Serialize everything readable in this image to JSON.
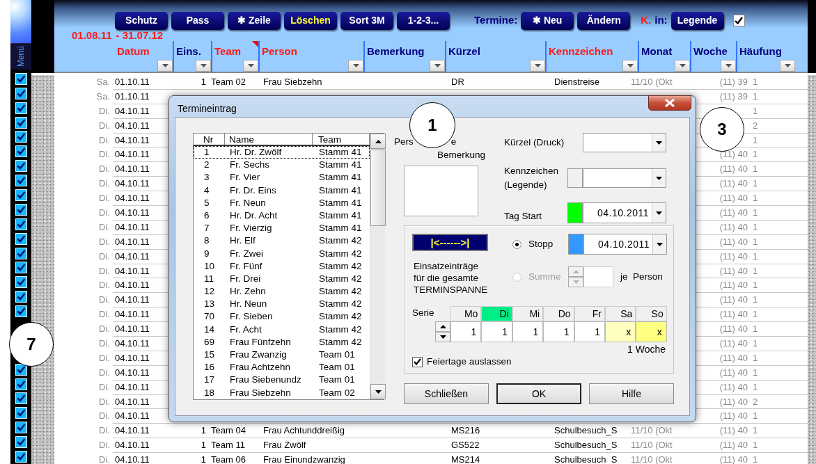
{
  "menu_label": "Menü",
  "toolbar": {
    "buttons": [
      {
        "label": "Schutz",
        "emphasis": false
      },
      {
        "label": "Pass",
        "emphasis": false
      },
      {
        "label": "✱ Zeile",
        "emphasis": false
      },
      {
        "label": "Löschen",
        "emphasis": true
      },
      {
        "label": "Sort 3M",
        "emphasis": false
      },
      {
        "label": "1-2-3...",
        "emphasis": false
      }
    ],
    "termine_label": "Termine:",
    "termine_buttons": [
      {
        "label": "✱ Neu"
      },
      {
        "label": "Ändern"
      }
    ],
    "k_label": "K.",
    "in_label": "in:",
    "legend_button": "Legende",
    "legend_checked": true,
    "date_from": "01.08.11",
    "date_to": "- 31.07.12"
  },
  "columns": [
    {
      "label": "Datum",
      "color": "#ff1a1a",
      "has_comment": false
    },
    {
      "label": "Eins.",
      "color": "#000080",
      "has_comment": false
    },
    {
      "label": "Team",
      "color": "#ff1a1a",
      "has_comment": true
    },
    {
      "label": "Person",
      "color": "#ff1a1a",
      "has_comment": false
    },
    {
      "label": "Bemerkung",
      "color": "#000080",
      "has_comment": false
    },
    {
      "label": "Kürzel",
      "color": "#000080",
      "has_comment": false
    },
    {
      "label": "Kennzeichen",
      "color": "#ff1a1a",
      "has_comment": false
    },
    {
      "label": "Monat",
      "color": "#000080",
      "has_comment": false
    },
    {
      "label": "Woche",
      "color": "#000080",
      "has_comment": false
    },
    {
      "label": "Häufung",
      "color": "#000080",
      "has_comment": false
    }
  ],
  "rows": [
    {
      "checked": true,
      "weekday": "Sa.",
      "date": "01.10.11",
      "eins": "1",
      "team": "Team 02",
      "person": "Frau Siebzehn",
      "kuerzel": "DR",
      "kennzeichen": "Dienstreise",
      "monat": "11/10 (Okt",
      "woche": "(11) 39",
      "haeufung": "1"
    },
    {
      "checked": true,
      "weekday": "Sa.",
      "date": "01.10.11",
      "woche": "(11) 39",
      "haeufung": "1"
    },
    {
      "checked": true,
      "weekday": "Di.",
      "date": "04.10.11",
      "haeufung": "1"
    },
    {
      "checked": true,
      "weekday": "Di.",
      "date": "04.10.11",
      "haeufung": "2"
    },
    {
      "checked": true,
      "weekday": "Di.",
      "date": "04.10.11",
      "haeufung": "1"
    },
    {
      "checked": true,
      "weekday": "Di.",
      "date": "04.10.11",
      "woche": "(11) 40",
      "haeufung": "1"
    },
    {
      "checked": true,
      "weekday": "Di.",
      "date": "04.10.11",
      "woche": "(11) 40",
      "haeufung": "1"
    },
    {
      "checked": true,
      "weekday": "Di.",
      "date": "04.10.11",
      "woche": "(11) 40",
      "haeufung": "1"
    },
    {
      "checked": true,
      "weekday": "Di.",
      "date": "04.10.11",
      "woche": "(11) 40",
      "haeufung": "1"
    },
    {
      "checked": true,
      "weekday": "Di.",
      "date": "04.10.11",
      "woche": "(11) 40",
      "haeufung": "1"
    },
    {
      "checked": true,
      "weekday": "Di.",
      "date": "04.10.11",
      "woche": "(11) 40",
      "haeufung": "1"
    },
    {
      "checked": true,
      "weekday": "Di.",
      "date": "04.10.11",
      "woche": "(11) 40",
      "haeufung": "1"
    },
    {
      "checked": true,
      "weekday": "Di.",
      "date": "04.10.11",
      "woche": "(11) 40",
      "haeufung": "1"
    },
    {
      "checked": true,
      "weekday": "Di.",
      "date": "04.10.11",
      "woche": "(11) 40",
      "haeufung": "1"
    },
    {
      "checked": true,
      "weekday": "Di.",
      "date": "04.10.11",
      "woche": "(11) 40",
      "haeufung": "1"
    },
    {
      "checked": true,
      "weekday": "Di.",
      "date": "04.10.11",
      "woche": "(11) 40",
      "haeufung": "1"
    },
    {
      "checked": true,
      "weekday": "Di.",
      "date": "04.10.11",
      "woche": "(11) 40",
      "haeufung": "1"
    },
    {
      "weekday": "Di.",
      "date": "04.10.11",
      "woche": "(11) 40",
      "haeufung": "1"
    },
    {
      "weekday": "Di.",
      "date": "04.10.11",
      "woche": "(11) 40",
      "haeufung": "1"
    },
    {
      "weekday": "Di.",
      "date": "04.10.11",
      "woche": "(11) 40",
      "haeufung": "1"
    },
    {
      "checked": true,
      "weekday": "Di.",
      "date": "04.10.11",
      "woche": "(11) 40",
      "haeufung": "1"
    },
    {
      "checked": true,
      "weekday": "Di.",
      "date": "04.10.11",
      "woche": "(11) 40",
      "haeufung": "1"
    },
    {
      "checked": true,
      "weekday": "Di.",
      "date": "04.10.11",
      "woche": "(11) 40",
      "haeufung": "2"
    },
    {
      "checked": true,
      "weekday": "Di.",
      "date": "04.10.11",
      "woche": "(11) 40",
      "haeufung": "1"
    },
    {
      "checked": true,
      "weekday": "Di.",
      "date": "04.10.11",
      "eins": "1",
      "team": "Team 04",
      "person": "Frau Achtunddreißig",
      "kuerzel": "MS216",
      "kennzeichen": "Schulbesuch_S",
      "monat": "11/10 (Okt",
      "woche": "(11) 40",
      "haeufung": "1"
    },
    {
      "checked": true,
      "weekday": "Di.",
      "date": "04.10.11",
      "eins": "1",
      "team": "Team 11",
      "person": "Frau Zwölf",
      "kuerzel": "GS522",
      "kennzeichen": "Schulbesuch_S",
      "monat": "11/10 (Okt",
      "woche": "(11) 40",
      "haeufung": "1"
    },
    {
      "checked": true,
      "weekday": "Di.",
      "date": "04.10.11",
      "eins": "1",
      "team": "Team 06",
      "person": "Frau Einundzwanzig",
      "kuerzel": "MS214",
      "kennzeichen": "Schulbesuch_S",
      "monat": "11/10 (Okt",
      "woche": "(11) 40",
      "haeufung": "1"
    }
  ],
  "dialog": {
    "title": "Termineintrag",
    "list": {
      "columns": [
        "Nr",
        "Name",
        "Team"
      ],
      "items": [
        {
          "nr": "1",
          "name": "Hr. Dr. Zwölf",
          "team": "Stamm 41",
          "focused": true
        },
        {
          "nr": "2",
          "name": "Fr. Sechs",
          "team": "Stamm 41",
          "focused": false
        },
        {
          "nr": "3",
          "name": "Fr. Vier",
          "team": "Stamm 41",
          "focused": false
        },
        {
          "nr": "4",
          "name": "Fr. Dr. Eins",
          "team": "Stamm 41",
          "focused": false
        },
        {
          "nr": "5",
          "name": "Fr. Neun",
          "team": "Stamm 41",
          "focused": false
        },
        {
          "nr": "6",
          "name": "Hr. Dr. Acht",
          "team": "Stamm 41",
          "focused": false
        },
        {
          "nr": "7",
          "name": "Fr. Vierzig",
          "team": "Stamm 41",
          "focused": false
        },
        {
          "nr": "8",
          "name": "Hr. Elf",
          "team": "Stamm 42",
          "focused": false
        },
        {
          "nr": "9",
          "name": "Fr. Zwei",
          "team": "Stamm 42",
          "focused": false
        },
        {
          "nr": "10",
          "name": "Fr. Fünf",
          "team": "Stamm 42",
          "focused": false
        },
        {
          "nr": "11",
          "name": "Fr. Drei",
          "team": "Stamm 42",
          "focused": false
        },
        {
          "nr": "12",
          "name": "Hr. Zehn",
          "team": "Stamm 42",
          "focused": false
        },
        {
          "nr": "13",
          "name": "Hr. Neun",
          "team": "Stamm 42",
          "focused": false
        },
        {
          "nr": "70",
          "name": "Fr. Sieben",
          "team": "Stamm 42",
          "focused": false
        },
        {
          "nr": "14",
          "name": "Fr. Acht",
          "team": "Stamm 42",
          "focused": false
        },
        {
          "nr": "69",
          "name": "Frau Fünfzehn",
          "team": "Stamm 42",
          "focused": false
        },
        {
          "nr": "15",
          "name": "Frau Zwanzig",
          "team": "Team 01",
          "focused": false
        },
        {
          "nr": "16",
          "name": "Frau Achtzehn",
          "team": "Team 01",
          "focused": false
        },
        {
          "nr": "17",
          "name": "Frau Siebenundz",
          "team": "Team 01",
          "focused": false
        },
        {
          "nr": "18",
          "name": "Frau Siebzehn",
          "team": "Team 02",
          "focused": false
        }
      ]
    },
    "remark_label_start": "Pers",
    "remark_label_end": "e",
    "remark_label_line2": "Bemerkung",
    "kuerzel_label": "Kürzel (Druck)",
    "kennzeichen_label": "Kennzeichen\n(Legende)",
    "start_label": "Tag  Start",
    "start_date": "04.10.2011",
    "span_button": "|<------>|",
    "span_text": "Einsatzeinträge\nfür die gesamte\nTERMINSPANNE",
    "modes": [
      {
        "label": "Stopp",
        "selected": true,
        "disabled": false
      },
      {
        "label": "Summe",
        "selected": false,
        "disabled": true
      }
    ],
    "stop_date": "04.10.2011",
    "per_person_label": "je  Person",
    "series_label": "Serie",
    "days": [
      {
        "label": "Mo",
        "value": "1",
        "selected": false,
        "color": "#ffffff"
      },
      {
        "label": "Di",
        "value": "1",
        "selected": true,
        "color": "#ffffff"
      },
      {
        "label": "Mi",
        "value": "1",
        "selected": false,
        "color": "#ffffff"
      },
      {
        "label": "Do",
        "value": "1",
        "selected": false,
        "color": "#ffffff"
      },
      {
        "label": "Fr",
        "value": "1",
        "selected": false,
        "color": "#ffffff"
      },
      {
        "label": "Sa",
        "value": "x",
        "selected": false,
        "color": "#ffffc0"
      },
      {
        "label": "So",
        "value": "x",
        "selected": false,
        "color": "#ffff80"
      }
    ],
    "weeks_label": "1 Woche",
    "skip_holidays": {
      "label": "Feiertage auslassen",
      "checked": true
    },
    "buttons": [
      {
        "label": "Schließen",
        "default": false
      },
      {
        "label": "OK",
        "default": true
      },
      {
        "label": "Hilfe",
        "default": false
      }
    ]
  },
  "callouts": [
    {
      "label": "1"
    },
    {
      "label": "3"
    },
    {
      "label": "7"
    }
  ]
}
